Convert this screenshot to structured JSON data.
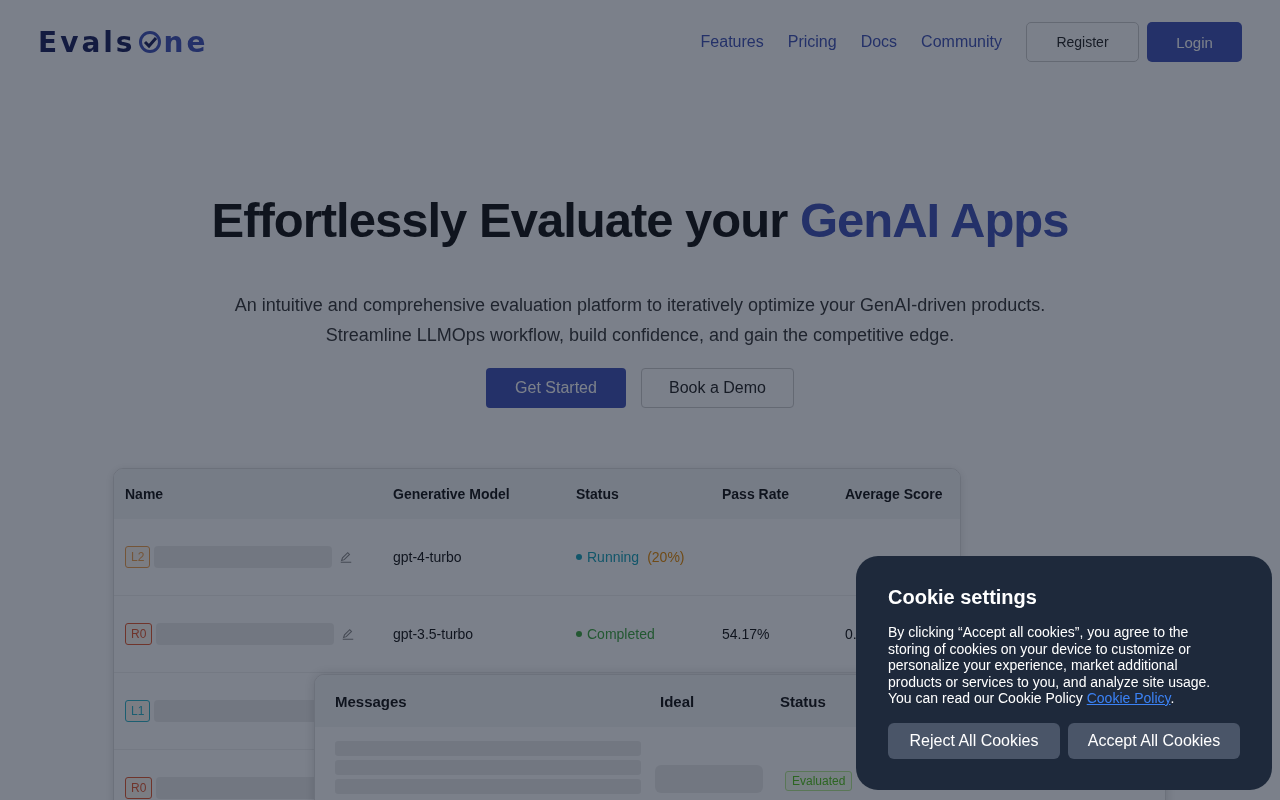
{
  "logo": {
    "prefix": "Evals",
    "suffix": "ne"
  },
  "nav": {
    "links": [
      "Features",
      "Pricing",
      "Docs",
      "Community"
    ],
    "register": "Register",
    "login": "Login"
  },
  "hero": {
    "title": "Effortlessly Evaluate your",
    "title_accent": "GenAI Apps",
    "subtitle": [
      "An intuitive and comprehensive evaluation platform to iteratively optimize your GenAI-driven products.",
      "Streamline LLMOps workflow, build confidence, and gain the competitive edge."
    ],
    "primary": "Get Started",
    "secondary": "Book a Demo"
  },
  "table": {
    "columns": [
      "Name",
      "Generative Model",
      "Status",
      "Pass Rate",
      "Average Score"
    ],
    "rows": [
      {
        "tag": "L2",
        "kind": "warning",
        "model": "gpt-4-turbo",
        "status": {
          "kind": "running",
          "label": "Running",
          "progress": "(20%)"
        }
      },
      {
        "tag": "R0",
        "kind": "danger",
        "model": "gpt-3.5-turbo",
        "status": {
          "kind": "completed",
          "label": "Completed"
        },
        "pass_rate": "54.17%",
        "score": "0."
      },
      {
        "tag": "L1",
        "kind": "info"
      },
      {
        "tag": "R0",
        "kind": "danger"
      }
    ]
  },
  "messages": {
    "columns": [
      "Messages",
      "Ideal",
      "Status"
    ],
    "badge": "Evaluated"
  },
  "cookie": {
    "title": "Cookie settings",
    "text": "By clicking “Accept all cookies”, you agree to the storing of cookies on your device to customize or personalize your experience, market additional products or services to you, and analyze site usage. You can read our Cookie Policy",
    "link": "Cookie Policy",
    "after": ".",
    "reject": "Reject All Cookies",
    "accept": "Accept All Cookies"
  }
}
